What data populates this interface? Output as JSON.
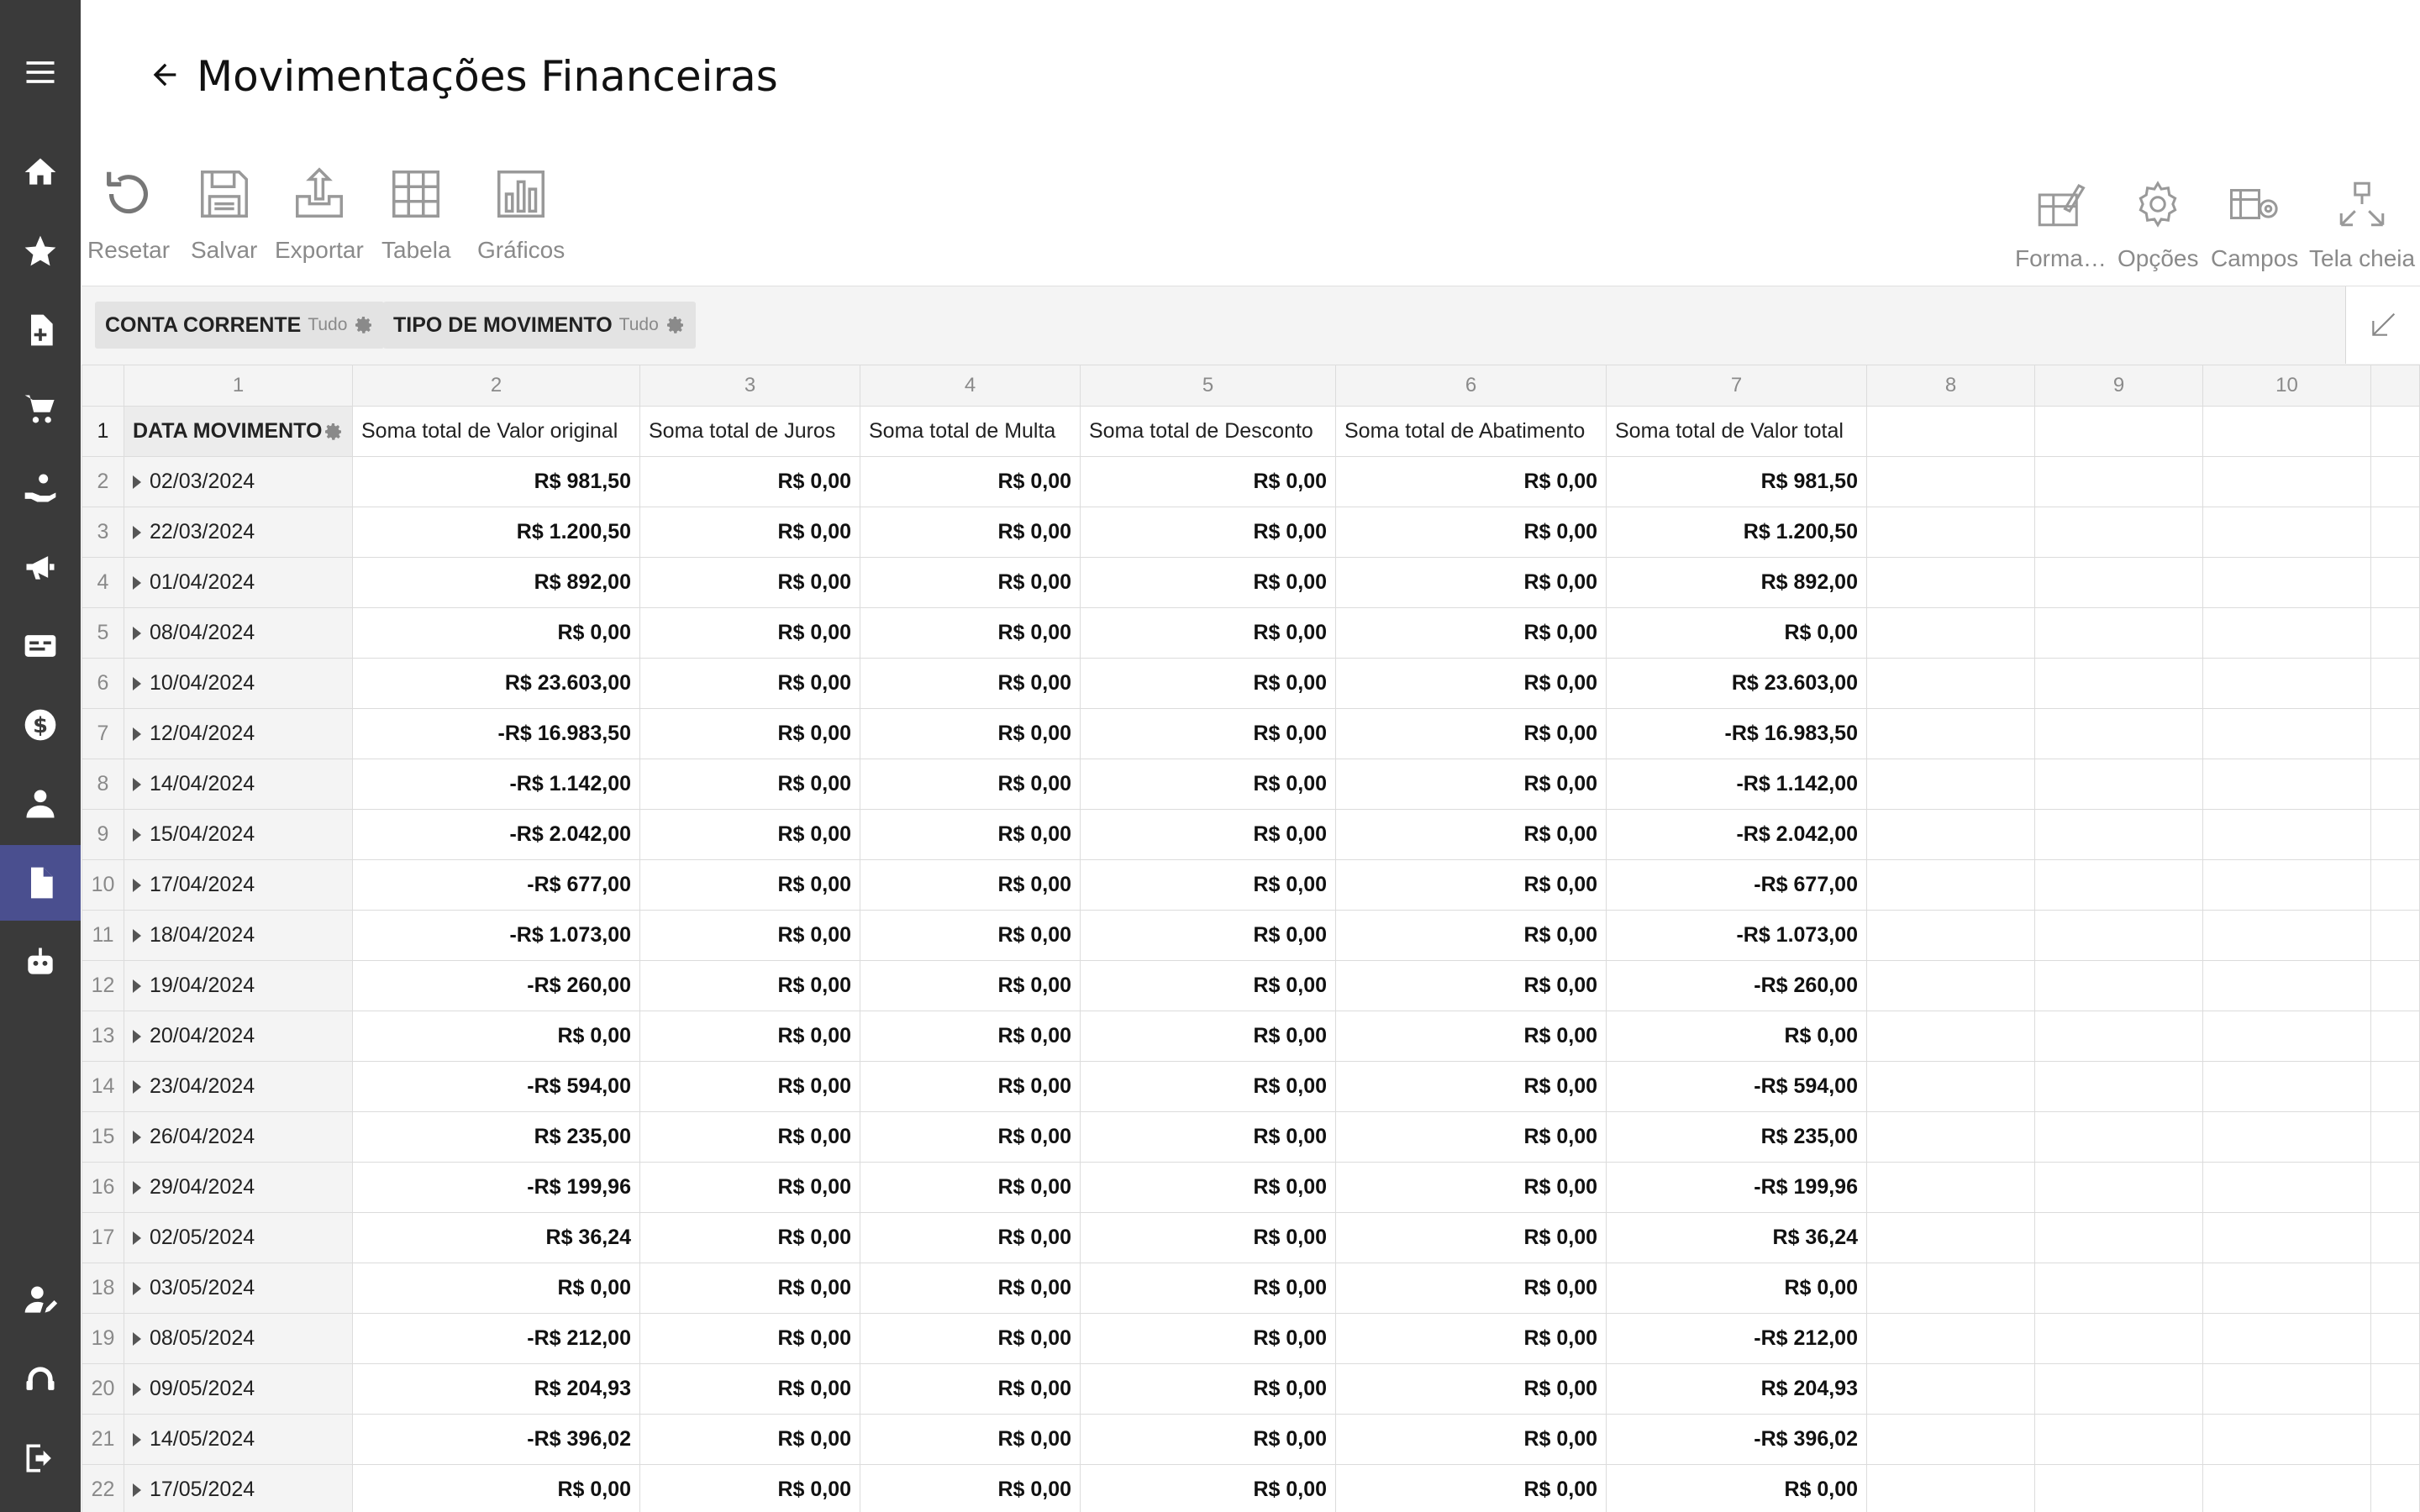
{
  "header": {
    "title": "Movimentações Financeiras"
  },
  "toolbar": {
    "left": [
      {
        "label": "Resetar",
        "icon": "reset-icon"
      },
      {
        "label": "Salvar",
        "icon": "save-icon"
      },
      {
        "label": "Exportar",
        "icon": "export-icon"
      },
      {
        "label": "Tabela",
        "icon": "table-icon"
      },
      {
        "label": "Gráficos",
        "icon": "chart-icon"
      }
    ],
    "right": [
      {
        "label": "Forma…",
        "icon": "format-icon"
      },
      {
        "label": "Opções",
        "icon": "options-icon"
      },
      {
        "label": "Campos",
        "icon": "fields-icon"
      },
      {
        "label": "Tela cheia",
        "icon": "fullscreen-icon"
      }
    ]
  },
  "filters": [
    {
      "label": "CONTA CORRENTE",
      "sub": "Tudo"
    },
    {
      "label": "TIPO DE MOVIMENTO",
      "sub": "Tudo"
    }
  ],
  "grid": {
    "column_numbers": [
      "1",
      "2",
      "3",
      "4",
      "5",
      "6",
      "7",
      "8",
      "9",
      "10"
    ],
    "row_header_label": "DATA MOVIMENTO",
    "headers": [
      "Soma total de Valor original",
      "Soma total de Juros",
      "Soma total de Multa",
      "Soma total de Desconto",
      "Soma total de Abatimento",
      "Soma total de Valor total"
    ],
    "rows": [
      {
        "n": "2",
        "date": "02/03/2024",
        "original": "R$ 981,50",
        "total": "R$ 981,50"
      },
      {
        "n": "3",
        "date": "22/03/2024",
        "original": "R$ 1.200,50",
        "total": "R$ 1.200,50"
      },
      {
        "n": "4",
        "date": "01/04/2024",
        "original": "R$ 892,00",
        "total": "R$ 892,00"
      },
      {
        "n": "5",
        "date": "08/04/2024",
        "original": "R$ 0,00",
        "total": "R$ 0,00"
      },
      {
        "n": "6",
        "date": "10/04/2024",
        "original": "R$ 23.603,00",
        "total": "R$ 23.603,00"
      },
      {
        "n": "7",
        "date": "12/04/2024",
        "original": "-R$ 16.983,50",
        "total": "-R$ 16.983,50"
      },
      {
        "n": "8",
        "date": "14/04/2024",
        "original": "-R$ 1.142,00",
        "total": "-R$ 1.142,00"
      },
      {
        "n": "9",
        "date": "15/04/2024",
        "original": "-R$ 2.042,00",
        "total": "-R$ 2.042,00"
      },
      {
        "n": "10",
        "date": "17/04/2024",
        "original": "-R$ 677,00",
        "total": "-R$ 677,00"
      },
      {
        "n": "11",
        "date": "18/04/2024",
        "original": "-R$ 1.073,00",
        "total": "-R$ 1.073,00"
      },
      {
        "n": "12",
        "date": "19/04/2024",
        "original": "-R$ 260,00",
        "total": "-R$ 260,00"
      },
      {
        "n": "13",
        "date": "20/04/2024",
        "original": "R$ 0,00",
        "total": "R$ 0,00"
      },
      {
        "n": "14",
        "date": "23/04/2024",
        "original": "-R$ 594,00",
        "total": "-R$ 594,00"
      },
      {
        "n": "15",
        "date": "26/04/2024",
        "original": "R$ 235,00",
        "total": "R$ 235,00"
      },
      {
        "n": "16",
        "date": "29/04/2024",
        "original": "-R$ 199,96",
        "total": "-R$ 199,96"
      },
      {
        "n": "17",
        "date": "02/05/2024",
        "original": "R$ 36,24",
        "total": "R$ 36,24"
      },
      {
        "n": "18",
        "date": "03/05/2024",
        "original": "R$ 0,00",
        "total": "R$ 0,00"
      },
      {
        "n": "19",
        "date": "08/05/2024",
        "original": "-R$ 212,00",
        "total": "-R$ 212,00"
      },
      {
        "n": "20",
        "date": "09/05/2024",
        "original": "R$ 204,93",
        "total": "R$ 204,93"
      },
      {
        "n": "21",
        "date": "14/05/2024",
        "original": "-R$ 396,02",
        "total": "-R$ 396,02"
      },
      {
        "n": "22",
        "date": "17/05/2024",
        "original": "R$ 0,00",
        "total": "R$ 0,00"
      }
    ],
    "zero_value": "R$ 0,00"
  },
  "sidebar": {
    "items": [
      {
        "icon": "menu-icon"
      },
      {
        "icon": "home-icon"
      },
      {
        "icon": "star-icon"
      },
      {
        "icon": "new-document-icon"
      },
      {
        "icon": "cart-icon"
      },
      {
        "icon": "hand-money-icon"
      },
      {
        "icon": "megaphone-icon"
      },
      {
        "icon": "bill-icon"
      },
      {
        "icon": "dollar-icon"
      },
      {
        "icon": "user-tie-icon"
      },
      {
        "icon": "report-document-icon"
      },
      {
        "icon": "robot-icon"
      },
      {
        "icon": "user-edit-icon"
      },
      {
        "icon": "support-icon"
      },
      {
        "icon": "logout-icon"
      }
    ],
    "active_color": "#4a4f8f",
    "background": "#3a3a3a"
  }
}
